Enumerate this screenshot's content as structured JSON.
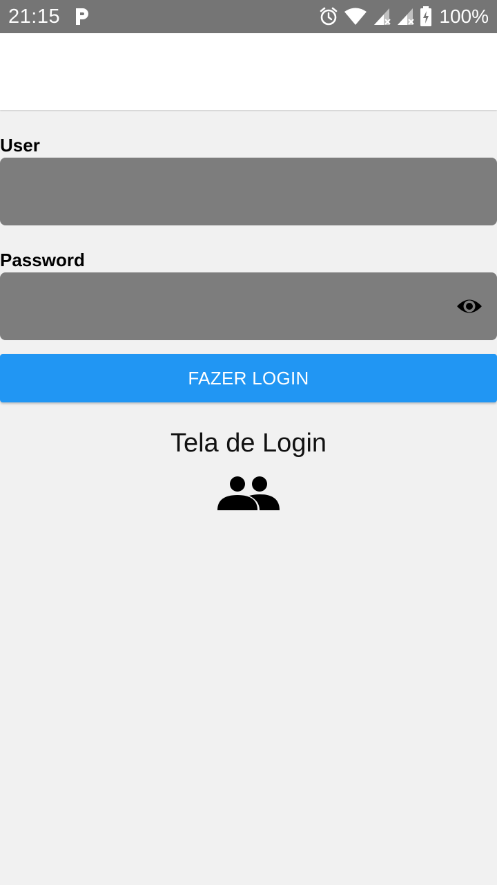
{
  "status_bar": {
    "time": "21:15",
    "battery": "100%",
    "icons": [
      "parking-icon",
      "alarm-icon",
      "wifi-icon",
      "signal-icon",
      "signal-icon",
      "battery-charging-icon"
    ]
  },
  "form": {
    "user_label": "User",
    "user_value": "",
    "password_label": "Password",
    "password_value": "",
    "toggle_icon": "eye-icon"
  },
  "login_button": {
    "label": "FAZER LOGIN"
  },
  "screen": {
    "title": "Tela de Login",
    "icon": "group-icon"
  },
  "colors": {
    "status_bar": "#757575",
    "background": "#f1f1f1",
    "input_fill": "#7d7d7d",
    "primary": "#2196f3"
  }
}
